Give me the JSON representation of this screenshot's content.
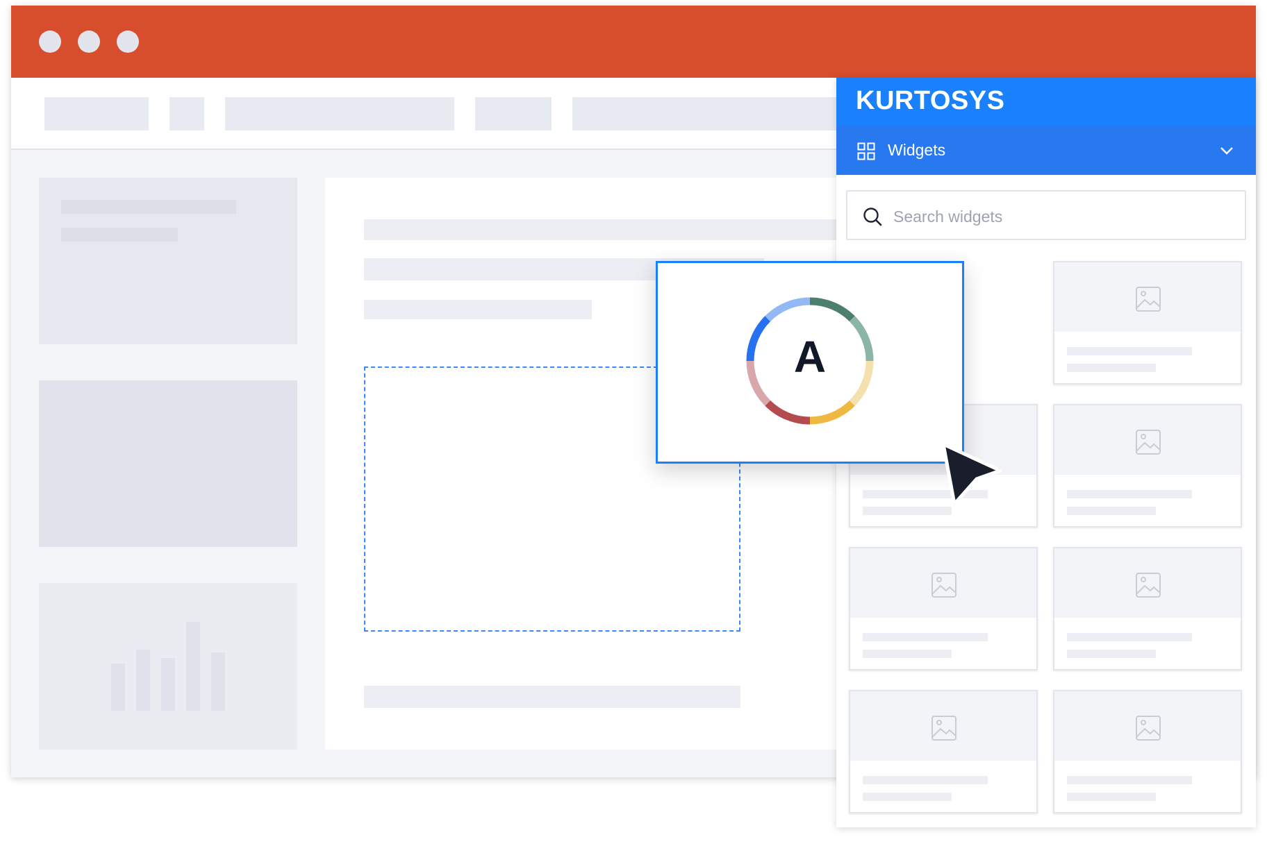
{
  "brand": {
    "name": "KURTOSYS"
  },
  "panel": {
    "section_label": "Widgets",
    "search": {
      "placeholder": "Search widgets",
      "value": ""
    },
    "tiles_count_visible": 8
  },
  "dragged_widget": {
    "letter": "A",
    "ring_colors": [
      "#4c7f6d",
      "#8ab5a8",
      "#f5e1ad",
      "#efb841",
      "#b44b4f",
      "#d9a7a9",
      "#2571f0",
      "#93b8f5"
    ]
  },
  "colors": {
    "titlebar": "#d64e2b",
    "brand_bar": "#1b80fc",
    "widgets_bar": "#2879f0",
    "accent": "#1b80fc"
  }
}
